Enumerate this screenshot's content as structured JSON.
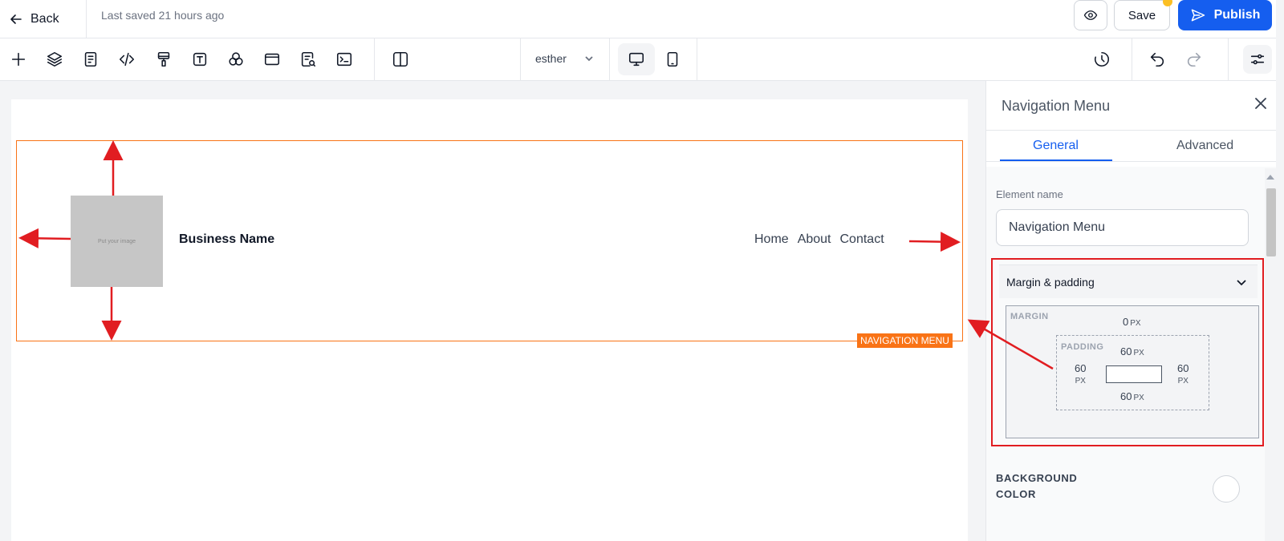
{
  "topbar": {
    "back_label": "Back",
    "last_saved": "Last saved 21 hours ago",
    "save_label": "Save",
    "publish_label": "Publish",
    "preview_icon": "eye-icon"
  },
  "toolbar": {
    "tools": [
      "plus-icon",
      "layers-icon",
      "page-icon",
      "code-icon",
      "paint-roller-icon",
      "text-icon",
      "shapes-icon",
      "browser-window-icon",
      "search-document-icon",
      "terminal-icon",
      "split-view-icon"
    ],
    "page_select_value": "esther",
    "devices": [
      "desktop-icon",
      "mobile-icon"
    ],
    "right_tools": [
      "history-icon",
      "undo-icon",
      "redo-icon",
      "settings-sliders-icon"
    ]
  },
  "canvas": {
    "image_placeholder_text": "Put your image",
    "business_name": "Business Name",
    "nav_links": [
      "Home",
      "About",
      "Contact"
    ],
    "element_badge": "NAVIGATION MENU"
  },
  "panel": {
    "title": "Navigation Menu",
    "tabs": [
      "General",
      "Advanced"
    ],
    "active_tab": "General",
    "element_name_label": "Element name",
    "element_name_value": "Navigation Menu",
    "section_title": "Margin & padding",
    "margin_label": "MARGIN",
    "margin_top": "0",
    "padding_label": "PADDING",
    "padding_top": "60",
    "padding_bottom": "60",
    "padding_left": "60",
    "padding_right": "60",
    "unit": "PX",
    "background_color_label": "BACKGROUND COLOR"
  },
  "colors": {
    "accent": "#155eef",
    "selection": "#f97316",
    "annotation": "#e11d21"
  }
}
